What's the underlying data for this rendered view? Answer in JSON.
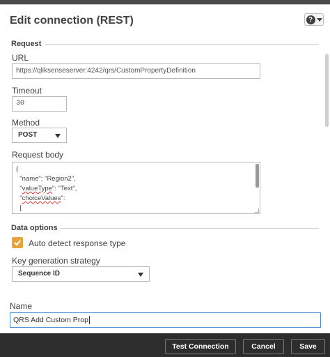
{
  "dialog": {
    "title": "Edit connection (REST)",
    "help_icon": "?"
  },
  "request": {
    "section_title": "Request",
    "url_label": "URL",
    "url_value": "https://qliksenseserver:4242/qrs/CustomPropertyDefinition",
    "timeout_label": "Timeout",
    "timeout_value": "30",
    "method_label": "Method",
    "method_value": "POST",
    "body_label": "Request body",
    "body_lines": [
      "{",
      "  \"name\": \"Region2\",",
      "  \"",
      "valueType",
      "\": \"Text\",",
      "  \"",
      "choiceValues",
      "\":",
      "  ["
    ]
  },
  "data_options": {
    "section_title": "Data options",
    "auto_detect_label": "Auto detect response type",
    "auto_detect_checked": true,
    "key_strategy_label": "Key generation strategy",
    "key_strategy_value": "Sequence ID"
  },
  "name": {
    "label": "Name",
    "value": "QRS Add Custom Prop"
  },
  "footer": {
    "test_button": "Test Connection",
    "cancel_button": "Cancel",
    "save_button": "Save"
  },
  "colors": {
    "accent": "#e8a33d",
    "focus": "#4a90d9",
    "footer_bg": "#2d2d2d"
  }
}
